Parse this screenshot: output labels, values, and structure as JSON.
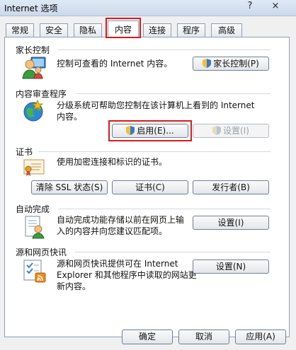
{
  "window": {
    "title": "Internet 选项",
    "help_label": "?",
    "close_label": "×"
  },
  "tabs": [
    {
      "label": "常规"
    },
    {
      "label": "安全"
    },
    {
      "label": "隐私"
    },
    {
      "label": "内容"
    },
    {
      "label": "连接"
    },
    {
      "label": "程序"
    },
    {
      "label": "高级"
    }
  ],
  "active_tab": "内容",
  "sections": {
    "parental": {
      "title": "家长控制",
      "desc": "控制可查看的 Internet 内容。",
      "button": "家长控制(P)"
    },
    "advisor": {
      "title": "内容审查程序",
      "desc": "分级系统可帮助您控制在该计算机上看到的 Internet 内容。",
      "enable_button": "启用(E)...",
      "settings_button": "设置(I)"
    },
    "certificates": {
      "title": "证书",
      "desc": "使用加密连接和标识的证书。",
      "clear_ssl_button": "清除 SSL 状态(S)",
      "certs_button": "证书(C)",
      "publishers_button": "发行者(B)"
    },
    "autocomplete": {
      "title": "自动完成",
      "desc": "自动完成功能存储以前在网页上输入的内容并向您建议匹配项。",
      "settings_button": "设置(I)"
    },
    "feeds": {
      "title": "源和网页快讯",
      "desc": "源和网页快讯提供可在 Internet Explorer 和其他程序中读取的网站更新内容。",
      "settings_button": "设置(N)"
    }
  },
  "footer": {
    "ok_button": "确定",
    "cancel_button": "取消",
    "apply_button": "应用(A)"
  },
  "colors": {
    "highlight": "#d81b1b",
    "panel_border": "#8d9fb5"
  }
}
